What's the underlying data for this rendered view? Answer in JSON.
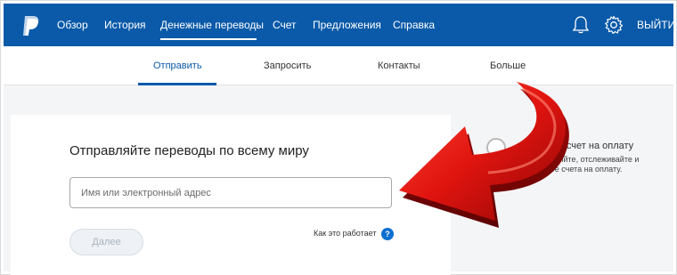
{
  "topnav": {
    "logo_icon": "paypal-logo-icon",
    "items": [
      {
        "label": "Обзор"
      },
      {
        "label": "История"
      },
      {
        "label": "Денежные переводы",
        "active": true
      },
      {
        "label": "Счет"
      },
      {
        "label": "Предложения"
      },
      {
        "label": "Справка"
      }
    ],
    "notifications_icon": "bell-icon",
    "settings_icon": "gear-icon",
    "logout_label": "ВЫЙТИ"
  },
  "subnav": {
    "tabs": [
      {
        "label": "Отправить",
        "active": true
      },
      {
        "label": "Запросить"
      },
      {
        "label": "Контакты"
      },
      {
        "label": "Больше"
      }
    ]
  },
  "send_card": {
    "title": "Отправляйте переводы по всему миру",
    "search_placeholder": "Имя или электронный адрес",
    "how_it_works": "Как это работает",
    "help_icon": "question-icon",
    "next_label": "Далее"
  },
  "invoice_panel": {
    "title": "авить счет на оплату",
    "description": "отправляйте, отслеживайте и авляйте счета на оплату."
  },
  "colors": {
    "brand_blue": "#0b5aa9",
    "page_bg": "#f4f5f7",
    "arrow_red": "#d8110e"
  }
}
